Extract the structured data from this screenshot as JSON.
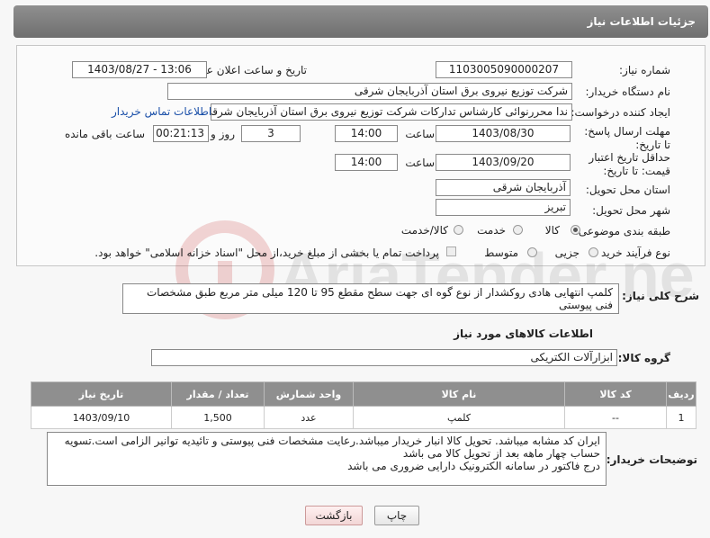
{
  "header": {
    "title": "جزئیات اطلاعات نیاز"
  },
  "form": {
    "need_number_label": "شماره نیاز:",
    "need_number": "1103005090000207",
    "announce_label": "تاریخ و ساعت اعلان عمومی:",
    "announce_value": "1403/08/27 - 13:06",
    "buyer_org_label": "نام دستگاه خریدار:",
    "buyer_org": "شرکت توزیع نیروی برق استان آذربایجان شرقی",
    "requester_label": "ایجاد کننده درخواست:",
    "requester": "ندا محررنوائی کارشناس تدارکات شرکت توزیع نیروی برق استان آذربایجان شرقی",
    "contact_link": "اطلاعات تماس خریدار",
    "reply_deadline_label": "مهلت ارسال پاسخ: تا تاریخ:",
    "reply_date": "1403/08/30",
    "time_label": "ساعت",
    "reply_time": "14:00",
    "days_value": "3",
    "days_label": "روز و",
    "remaining_time": "00:21:13",
    "remaining_label": "ساعت باقی مانده",
    "price_validity_label": "حداقل تاریخ اعتبار قیمت: تا تاریخ:",
    "price_date": "1403/09/20",
    "price_time": "14:00",
    "province_label": "استان محل تحویل:",
    "province": "آذربایجان شرقی",
    "city_label": "شهر محل تحویل:",
    "city": "تبریز",
    "category_label": "طبقه بندی موضوعی:",
    "category_options": [
      "کالا",
      "خدمت",
      "کالا/خدمت"
    ],
    "category_selected": "کالا",
    "process_label": "نوع فرآیند خرید :",
    "process_options": [
      "جزیی",
      "متوسط"
    ],
    "process_selected": "متوسط",
    "payment_note": "پرداخت تمام یا بخشی از مبلغ خرید،از محل \"اسناد خزانه اسلامی\" خواهد بود."
  },
  "description": {
    "label": "شرح کلی نیاز:",
    "text": "کلمپ انتهایی هادی روکشدار از نوع گوه ای جهت سطح مقطع 95 تا 120 میلی متر مربع طبق مشخصات فنی پیوستی"
  },
  "goods": {
    "section_title": "اطلاعات کالاهای مورد نیاز",
    "group_label": "گروه کالا:",
    "group_value": "ابزارآلات الکتریکی",
    "columns": [
      "ردیف",
      "کد کالا",
      "نام کالا",
      "واحد شمارش",
      "تعداد / مقدار",
      "تاریخ نیاز"
    ],
    "rows": [
      {
        "row": "1",
        "code": "--",
        "name": "کلمپ",
        "unit": "عدد",
        "qty": "1,500",
        "date": "1403/09/10"
      }
    ]
  },
  "buyer_notes": {
    "label": "توضیحات خریدار:",
    "lines": [
      "ایران کد مشابه میباشد. تحویل کالا انبار خریدار میباشد.رعایت مشخصات فنی پیوستی و تائیدیه توانیر الزامی است.تسویه",
      "حساب چهار ماهه بعد از تحویل کالا می باشد",
      "درج فاکتور در سامانه الکترونیک دارایی ضروری می باشد"
    ]
  },
  "buttons": {
    "print": "چاپ",
    "back": "بازگشت"
  },
  "watermark": {
    "text": "AriaTender.neT"
  }
}
